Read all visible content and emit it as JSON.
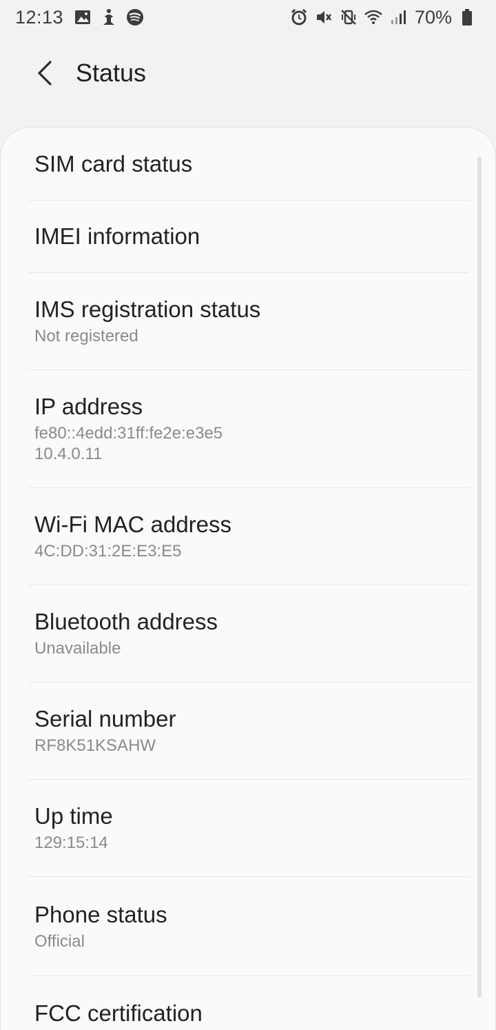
{
  "status_bar": {
    "time": "12:13",
    "battery_percent": "70%",
    "left_icons": [
      "gallery-icon",
      "accessibility-icon",
      "spotify-icon"
    ],
    "right_icons": [
      "alarm-icon",
      "mute-icon",
      "vibrate-icon",
      "wifi-icon",
      "signal-icon",
      "battery-icon"
    ]
  },
  "header": {
    "title": "Status",
    "back_icon": "chevron-left-icon"
  },
  "items": [
    {
      "title": "SIM card status"
    },
    {
      "title": "IMEI information"
    },
    {
      "title": "IMS registration status",
      "subtitle": "Not registered"
    },
    {
      "title": "IP address",
      "subtitle": "fe80::4edd:31ff:fe2e:e3e5",
      "subtitle2": "10.4.0.11"
    },
    {
      "title": "Wi-Fi MAC address",
      "subtitle": "4C:DD:31:2E:E3:E5"
    },
    {
      "title": "Bluetooth address",
      "subtitle": "Unavailable"
    },
    {
      "title": "Serial number",
      "subtitle": "RF8K51KSAHW"
    },
    {
      "title": "Up time",
      "subtitle": "129:15:14"
    },
    {
      "title": "Phone status",
      "subtitle": "Official"
    },
    {
      "title": "FCC certification"
    }
  ],
  "colors": {
    "background": "#f2f2f2",
    "card": "#fafafa",
    "text_primary": "#222222",
    "text_secondary": "#8a8a8a",
    "divider": "#e6e6e6"
  }
}
